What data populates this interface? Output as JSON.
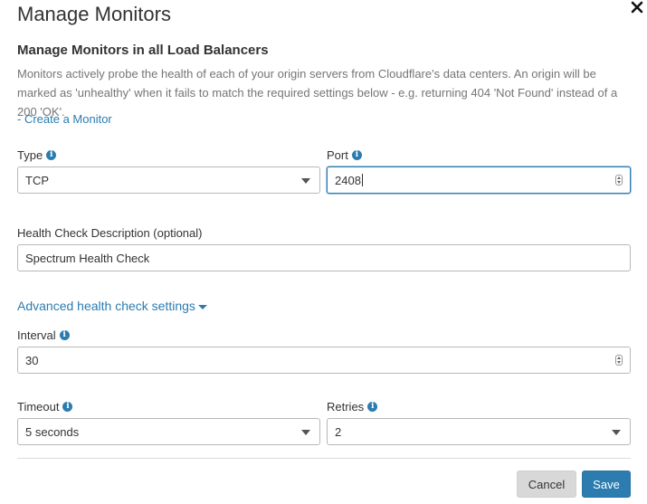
{
  "modal": {
    "title": "Manage Monitors",
    "close_glyph": "✕",
    "subtitle": "Manage Monitors in all Load Balancers",
    "description": "Monitors actively probe the health of each of your origin servers from Cloudflare's data centers. An origin will be marked as 'unhealthy' when it fails to match the required settings below - e.g. returning 404 'Not Found' instead of a 200 'OK'.",
    "create_link": "- Create a Monitor"
  },
  "form": {
    "type": {
      "label": "Type",
      "value": "TCP"
    },
    "port": {
      "label": "Port",
      "value": "2408"
    },
    "health_desc": {
      "label": "Health Check Description (optional)",
      "value": "Spectrum Health Check"
    },
    "advanced_toggle": "Advanced health check settings",
    "interval": {
      "label": "Interval",
      "value": "30"
    },
    "timeout": {
      "label": "Timeout",
      "value": "5 seconds"
    },
    "retries": {
      "label": "Retries",
      "value": "2"
    },
    "info_glyph": "i"
  },
  "actions": {
    "cancel": "Cancel",
    "save": "Save"
  },
  "colors": {
    "accent": "#2c7cb0",
    "text": "#333333",
    "muted": "#757575"
  },
  "icons": {
    "close": "close-icon",
    "info": "info-icon",
    "dropdown": "chevron-down-icon",
    "spinner": "spinner-icon"
  }
}
